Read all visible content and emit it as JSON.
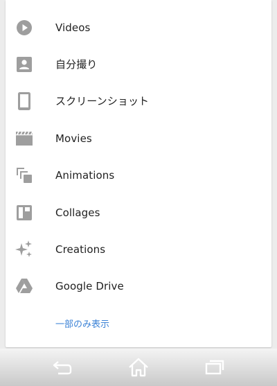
{
  "menu": {
    "items": [
      {
        "label": "Videos",
        "icon": "play-circle-icon"
      },
      {
        "label": "自分撮り",
        "icon": "portrait-icon"
      },
      {
        "label": "スクリーンショット",
        "icon": "phone-icon"
      },
      {
        "label": "Movies",
        "icon": "clapperboard-icon"
      },
      {
        "label": "Animations",
        "icon": "stacked-frames-icon"
      },
      {
        "label": "Collages",
        "icon": "collage-icon"
      },
      {
        "label": "Creations",
        "icon": "sparkle-icon"
      },
      {
        "label": "Google Drive",
        "icon": "drive-icon"
      }
    ],
    "show_less_label": "一部のみ表示"
  },
  "colors": {
    "icon": "#9e9e9e",
    "text": "#212121",
    "link": "#3b82d6",
    "nav_icon": "#ffffff"
  },
  "navbar": {
    "buttons": [
      "back-icon",
      "home-icon",
      "recents-icon"
    ]
  }
}
